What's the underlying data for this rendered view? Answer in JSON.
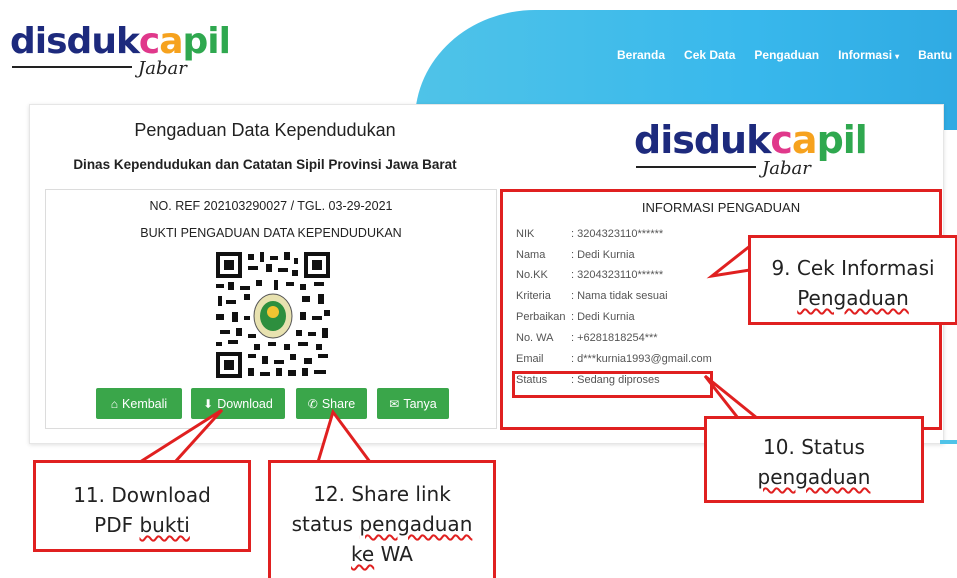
{
  "header": {
    "logo_main": [
      "dis",
      "duk",
      "c",
      "a",
      "pil"
    ],
    "logo_sub": "Jabar",
    "nav": [
      "Beranda",
      "Cek Data",
      "Pengaduan",
      "Informasi",
      "Bantu"
    ],
    "caret": "▾"
  },
  "form": {
    "title": "Pengaduan Data Kependudukan",
    "subtitle": "Dinas Kependudukan dan Catatan Sipil Provinsi Jawa Barat",
    "ref": "NO. REF 202103290027 / TGL. 03-29-2021",
    "bukti": "BUKTI PENGADUAN DATA KEPENDUDUKAN"
  },
  "buttons": {
    "kembali": "Kembali",
    "download": "Download",
    "share": "Share",
    "tanya": "Tanya"
  },
  "info": {
    "title": "INFORMASI PENGADUAN",
    "rows": [
      {
        "label": "NIK",
        "value": ": 3204323110******"
      },
      {
        "label": "Nama",
        "value": ": Dedi Kurnia"
      },
      {
        "label": "No.KK",
        "value": ": 3204323110******"
      },
      {
        "label": "Kriteria",
        "value": ": Nama tidak sesuai"
      },
      {
        "label": "Perbaikan",
        "value": ": Dedi Kurnia"
      },
      {
        "label": "No. WA",
        "value": ": +6281818254***"
      },
      {
        "label": "Email",
        "value": ": d***kurnia1993@gmail.com"
      },
      {
        "label": "Status",
        "value": ": Sedang diproses"
      }
    ]
  },
  "callouts": {
    "c9_line1": "9. Cek Informasi",
    "c9_line2": "Pengaduan",
    "c10_line1": "10. Status",
    "c10_line2": "pengaduan",
    "c11_line1": "11. Download",
    "c11_line2a": "PDF ",
    "c11_line2b": "bukti",
    "c12_line1": "12. Share link",
    "c12_line2a": "status ",
    "c12_line2b": "pengaduan",
    "c12_line3a": "ke",
    "c12_line3b": " WA"
  },
  "colors": {
    "accent_green": "#3aa64a",
    "header_blue": "#38b8ec",
    "annotation_red": "#e02020"
  }
}
